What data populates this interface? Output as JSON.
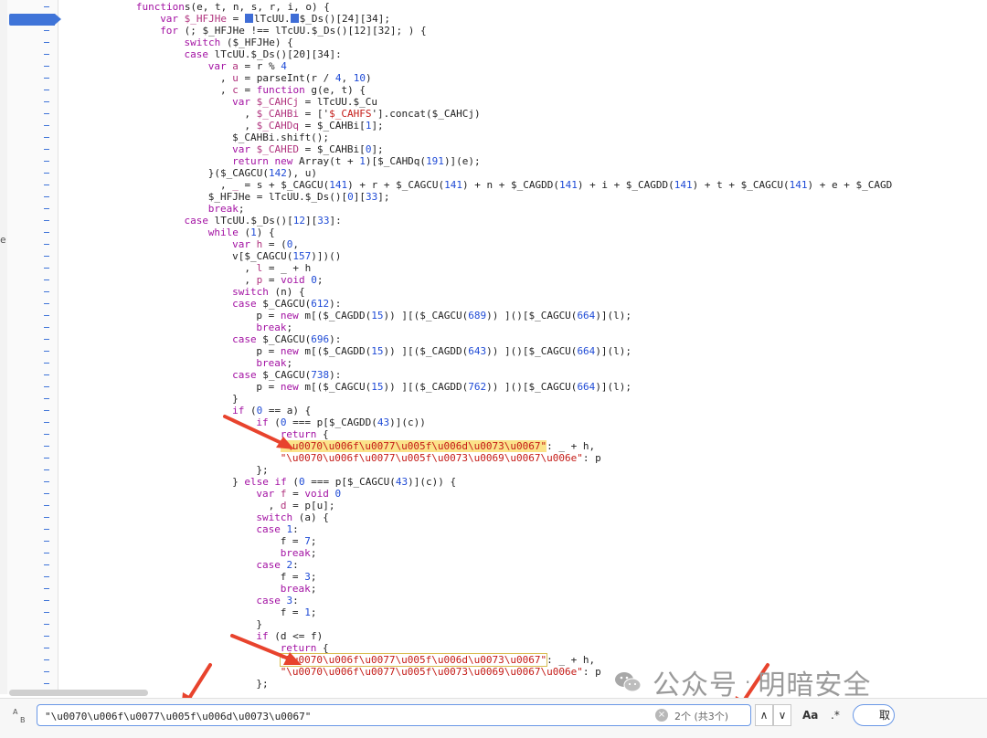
{
  "left_fragment": "e",
  "code_lines": [
    {
      "ind": 3,
      "s": [
        [
          "kw",
          "function"
        ],
        [
          "",
          "s(e, t, n, s, r, i, o) {"
        ]
      ]
    },
    {
      "ind": 4,
      "s": [
        [
          "kw",
          "var"
        ],
        [
          "def",
          " $_HFJHe"
        ],
        [
          "",
          " = "
        ],
        [
          "cur",
          ""
        ],
        [
          "",
          "lTcUU."
        ],
        [
          "cur",
          ""
        ],
        [
          "",
          "$_Ds()[24][34];"
        ]
      ]
    },
    {
      "ind": 4,
      "s": [
        [
          "kw",
          "for"
        ],
        [
          "",
          " (; $_HFJHe !== lTcUU.$_Ds()[12][32]; ) {"
        ]
      ]
    },
    {
      "ind": 5,
      "s": [
        [
          "kw",
          "switch"
        ],
        [
          "",
          " ($_HFJHe) {"
        ]
      ]
    },
    {
      "ind": 5,
      "s": [
        [
          "kw",
          "case"
        ],
        [
          "",
          " lTcUU.$_Ds()[20][34]:"
        ]
      ]
    },
    {
      "ind": 6,
      "s": [
        [
          "kw",
          "var"
        ],
        [
          "def",
          " a"
        ],
        [
          "",
          " = r % "
        ],
        [
          "num",
          "4"
        ]
      ]
    },
    {
      "ind": 6,
      "s": [
        [
          "",
          "  , "
        ],
        [
          "def",
          "u"
        ],
        [
          "",
          " = parseInt(r / "
        ],
        [
          "num",
          "4"
        ],
        [
          ", ",
          ", "
        ],
        [
          "num",
          "10"
        ],
        [
          "",
          ")"
        ]
      ]
    },
    {
      "ind": 6,
      "s": [
        [
          "",
          "  , "
        ],
        [
          "def",
          "c"
        ],
        [
          "",
          " = "
        ],
        [
          "kw",
          "function"
        ],
        [
          "",
          " g(e, t) {"
        ]
      ]
    },
    {
      "ind": 7,
      "s": [
        [
          "kw",
          "var"
        ],
        [
          "def",
          " $_CAHCj"
        ],
        [
          "",
          " = lTcUU.$_Cu"
        ]
      ]
    },
    {
      "ind": 7,
      "s": [
        [
          "",
          "  , "
        ],
        [
          "def",
          "$_CAHBi"
        ],
        [
          "",
          " = ['"
        ],
        [
          "str",
          "$_CAHFS"
        ],
        [
          "",
          "'].concat($_CAHCj)"
        ]
      ]
    },
    {
      "ind": 7,
      "s": [
        [
          "",
          "  , "
        ],
        [
          "def",
          "$_CAHDq"
        ],
        [
          "",
          " = $_CAHBi["
        ],
        [
          "num",
          "1"
        ],
        [
          "",
          "];"
        ]
      ]
    },
    {
      "ind": 7,
      "s": [
        [
          "",
          "$_CAHBi.shift();"
        ]
      ]
    },
    {
      "ind": 7,
      "s": [
        [
          "kw",
          "var"
        ],
        [
          "def",
          " $_CAHED"
        ],
        [
          "",
          " = $_CAHBi["
        ],
        [
          "num",
          "0"
        ],
        [
          "",
          "];"
        ]
      ]
    },
    {
      "ind": 7,
      "s": [
        [
          "kw",
          "return"
        ],
        [
          "kw",
          " new"
        ],
        [
          "",
          " Array(t + "
        ],
        [
          "num",
          "1"
        ],
        [
          "",
          ")[$_CAHDq("
        ],
        [
          "num",
          "191"
        ],
        [
          "",
          ")](e);"
        ]
      ]
    },
    {
      "ind": 6,
      "s": [
        [
          "",
          "}($_CAGCU("
        ],
        [
          "num",
          "142"
        ],
        [
          "",
          "), u)"
        ]
      ]
    },
    {
      "ind": 6,
      "s": [
        [
          "",
          "  , "
        ],
        [
          "def",
          "_"
        ],
        [
          "",
          " = s + $_CAGCU("
        ],
        [
          "num",
          "141"
        ],
        [
          "",
          ") + r + $_CAGCU("
        ],
        [
          "num",
          "141"
        ],
        [
          "",
          ") + n + $_CAGDD("
        ],
        [
          "num",
          "141"
        ],
        [
          "",
          ") + i + $_CAGDD("
        ],
        [
          "num",
          "141"
        ],
        [
          "",
          ") + t + $_CAGCU("
        ],
        [
          "num",
          "141"
        ],
        [
          "",
          ") + e + $_CAGDD("
        ]
      ]
    },
    {
      "ind": 6,
      "s": [
        [
          "",
          "$_HFJHe = lTcUU.$_Ds()["
        ],
        [
          "num",
          "0"
        ],
        [
          "",
          "]["
        ],
        [
          "num",
          "33"
        ],
        [
          "",
          "];"
        ]
      ]
    },
    {
      "ind": 6,
      "s": [
        [
          "kw",
          "break"
        ],
        [
          "",
          ";"
        ]
      ]
    },
    {
      "ind": 5,
      "s": [
        [
          "kw",
          "case"
        ],
        [
          "",
          " lTcUU.$_Ds()["
        ],
        [
          "num",
          "12"
        ],
        [
          "",
          "]["
        ],
        [
          "num",
          "33"
        ],
        [
          "",
          "]:"
        ]
      ]
    },
    {
      "ind": 6,
      "s": [
        [
          "kw",
          "while"
        ],
        [
          "",
          " ("
        ],
        [
          "num",
          "1"
        ],
        [
          "",
          ") {"
        ]
      ]
    },
    {
      "ind": 7,
      "s": [
        [
          "kw",
          "var"
        ],
        [
          "def",
          " h"
        ],
        [
          "",
          " = ("
        ],
        [
          "num",
          "0"
        ],
        [
          "",
          ","
        ]
      ]
    },
    {
      "ind": 7,
      "s": [
        [
          "",
          "v[$_CAGCU("
        ],
        [
          "num",
          "157"
        ],
        [
          "",
          ")])()"
        ]
      ]
    },
    {
      "ind": 7,
      "s": [
        [
          "",
          "  , "
        ],
        [
          "def",
          "l"
        ],
        [
          "",
          " = _ + h"
        ]
      ]
    },
    {
      "ind": 7,
      "s": [
        [
          "",
          "  , "
        ],
        [
          "def",
          "p"
        ],
        [
          "",
          " = "
        ],
        [
          "kw",
          "void"
        ],
        [
          "",
          " "
        ],
        [
          "num",
          "0"
        ],
        [
          "",
          ";"
        ]
      ]
    },
    {
      "ind": 7,
      "s": [
        [
          "kw",
          "switch"
        ],
        [
          "",
          " (n) {"
        ]
      ]
    },
    {
      "ind": 7,
      "s": [
        [
          "kw",
          "case"
        ],
        [
          "",
          " $_CAGCU("
        ],
        [
          "num",
          "612"
        ],
        [
          "",
          "):"
        ]
      ]
    },
    {
      "ind": 8,
      "s": [
        [
          "",
          "p = "
        ],
        [
          "kw",
          "new"
        ],
        [
          "",
          " m[($_CAGDD("
        ],
        [
          "num",
          "15"
        ],
        [
          "",
          ")) ][($_CAGCU("
        ],
        [
          "num",
          "689"
        ],
        [
          "",
          ")) ]()[$_CAGCU("
        ],
        [
          "num",
          "664"
        ],
        [
          "",
          ")](l);"
        ]
      ]
    },
    {
      "ind": 8,
      "s": [
        [
          "kw",
          "break"
        ],
        [
          "",
          ";"
        ]
      ]
    },
    {
      "ind": 7,
      "s": [
        [
          "kw",
          "case"
        ],
        [
          "",
          " $_CAGCU("
        ],
        [
          "num",
          "696"
        ],
        [
          "",
          "):"
        ]
      ]
    },
    {
      "ind": 8,
      "s": [
        [
          "",
          "p = "
        ],
        [
          "kw",
          "new"
        ],
        [
          "",
          " m[($_CAGDD("
        ],
        [
          "num",
          "15"
        ],
        [
          "",
          ")) ][($_CAGDD("
        ],
        [
          "num",
          "643"
        ],
        [
          "",
          ")) ]()[$_CAGCU("
        ],
        [
          "num",
          "664"
        ],
        [
          "",
          ")](l);"
        ]
      ]
    },
    {
      "ind": 8,
      "s": [
        [
          "kw",
          "break"
        ],
        [
          "",
          ";"
        ]
      ]
    },
    {
      "ind": 7,
      "s": [
        [
          "kw",
          "case"
        ],
        [
          "",
          " $_CAGCU("
        ],
        [
          "num",
          "738"
        ],
        [
          "",
          "):"
        ]
      ]
    },
    {
      "ind": 8,
      "s": [
        [
          "",
          "p = "
        ],
        [
          "kw",
          "new"
        ],
        [
          "",
          " m[($_CAGCU("
        ],
        [
          "num",
          "15"
        ],
        [
          "",
          ")) ][($_CAGDD("
        ],
        [
          "num",
          "762"
        ],
        [
          "",
          ")) ]()[$_CAGCU("
        ],
        [
          "num",
          "664"
        ],
        [
          "",
          ")](l);"
        ]
      ]
    },
    {
      "ind": 7,
      "s": [
        [
          "",
          "}"
        ]
      ]
    },
    {
      "ind": 7,
      "s": [
        [
          "kw",
          "if"
        ],
        [
          "",
          " ("
        ],
        [
          "num",
          "0"
        ],
        [
          "",
          " == a) {"
        ]
      ]
    },
    {
      "ind": 8,
      "s": [
        [
          "kw",
          "if"
        ],
        [
          "",
          " ("
        ],
        [
          "num",
          "0"
        ],
        [
          "",
          " === p[$_CAGDD("
        ],
        [
          "num",
          "43"
        ],
        [
          "",
          ")](c))"
        ]
      ]
    },
    {
      "ind": 9,
      "s": [
        [
          "kw",
          "return"
        ],
        [
          "",
          " {"
        ]
      ]
    },
    {
      "ind": 9,
      "s": [
        [
          "hl",
          "\"\\u0070\\u006f\\u0077\\u005f\\u006d\\u0073\\u0067\""
        ],
        [
          "",
          ": _ + h,"
        ]
      ]
    },
    {
      "ind": 9,
      "s": [
        [
          "str",
          "\"\\u0070\\u006f\\u0077\\u005f\\u0073\\u0069\\u0067\\u006e\""
        ],
        [
          "",
          ": p"
        ]
      ]
    },
    {
      "ind": 8,
      "s": [
        [
          "",
          "};"
        ]
      ]
    },
    {
      "ind": 7,
      "s": [
        [
          "",
          "} "
        ],
        [
          "kw",
          "else if"
        ],
        [
          "",
          " ("
        ],
        [
          "num",
          "0"
        ],
        [
          "",
          " === p[$_CAGCU("
        ],
        [
          "num",
          "43"
        ],
        [
          "",
          ")](c)) {"
        ]
      ]
    },
    {
      "ind": 8,
      "s": [
        [
          "kw",
          "var"
        ],
        [
          "def",
          " f"
        ],
        [
          "",
          " = "
        ],
        [
          "kw",
          "void"
        ],
        [
          "",
          " "
        ],
        [
          "num",
          "0"
        ]
      ]
    },
    {
      "ind": 8,
      "s": [
        [
          "",
          "  , "
        ],
        [
          "def",
          "d"
        ],
        [
          "",
          " = p[u];"
        ]
      ]
    },
    {
      "ind": 8,
      "s": [
        [
          "kw",
          "switch"
        ],
        [
          "",
          " (a) {"
        ]
      ]
    },
    {
      "ind": 8,
      "s": [
        [
          "kw",
          "case"
        ],
        [
          "",
          " "
        ],
        [
          "num",
          "1"
        ],
        [
          "",
          ":"
        ]
      ]
    },
    {
      "ind": 9,
      "s": [
        [
          "",
          "f = "
        ],
        [
          "num",
          "7"
        ],
        [
          "",
          ";"
        ]
      ]
    },
    {
      "ind": 9,
      "s": [
        [
          "kw",
          "break"
        ],
        [
          "",
          ";"
        ]
      ]
    },
    {
      "ind": 8,
      "s": [
        [
          "kw",
          "case"
        ],
        [
          "",
          " "
        ],
        [
          "num",
          "2"
        ],
        [
          "",
          ":"
        ]
      ]
    },
    {
      "ind": 9,
      "s": [
        [
          "",
          "f = "
        ],
        [
          "num",
          "3"
        ],
        [
          "",
          ";"
        ]
      ]
    },
    {
      "ind": 9,
      "s": [
        [
          "kw",
          "break"
        ],
        [
          "",
          ";"
        ]
      ]
    },
    {
      "ind": 8,
      "s": [
        [
          "kw",
          "case"
        ],
        [
          "",
          " "
        ],
        [
          "num",
          "3"
        ],
        [
          "",
          ":"
        ]
      ]
    },
    {
      "ind": 9,
      "s": [
        [
          "",
          "f = "
        ],
        [
          "num",
          "1"
        ],
        [
          "",
          ";"
        ]
      ]
    },
    {
      "ind": 8,
      "s": [
        [
          "",
          "}"
        ]
      ]
    },
    {
      "ind": 8,
      "s": [
        [
          "kw",
          "if"
        ],
        [
          "",
          " (d <= f)"
        ]
      ]
    },
    {
      "ind": 9,
      "s": [
        [
          "kw",
          "return"
        ],
        [
          "",
          " {"
        ]
      ]
    },
    {
      "ind": 9,
      "s": [
        [
          "hlb",
          "\"\\u0070\\u006f\\u0077\\u005f\\u006d\\u0073\\u0067\""
        ],
        [
          "",
          ": _ + h,"
        ]
      ]
    },
    {
      "ind": 9,
      "s": [
        [
          "str",
          "\"\\u0070\\u006f\\u0077\\u005f\\u0073\\u0069\\u0067\\u006e\""
        ],
        [
          "",
          ": p"
        ]
      ]
    },
    {
      "ind": 8,
      "s": [
        [
          "",
          "};"
        ]
      ]
    }
  ],
  "search": {
    "value": "\"\\u0070\\u006f\\u0077\\u005f\\u006d\\u0073\\u0067\"",
    "clear_icon": "×",
    "match_count": "2个 (共3个)",
    "prev_icon": "∧",
    "next_icon": "∨",
    "case_label": "Aa",
    "regex_label": ".*",
    "cancel_label": "取",
    "case_icon_top": "A",
    "case_icon_bottom": "B"
  },
  "watermark": {
    "left": "公众号",
    "dot": "·",
    "right": "明暗安全"
  },
  "colors": {
    "keyword": "#a312a3",
    "number": "#1f4bd6",
    "string": "#c41a16",
    "annotation_arrow": "#e8432d",
    "breakpoint": "#3f74d8"
  }
}
